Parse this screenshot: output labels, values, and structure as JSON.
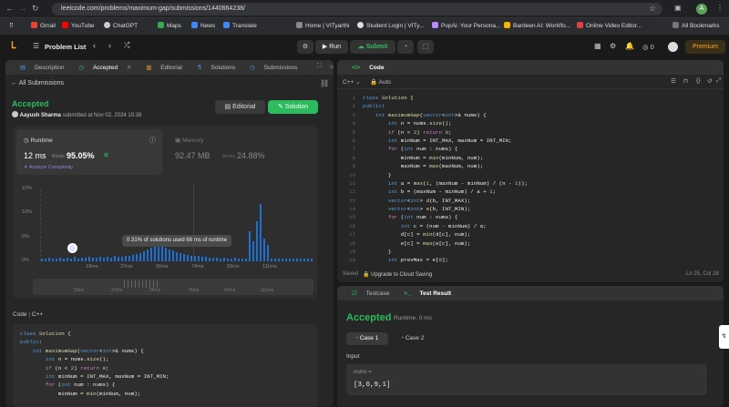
{
  "browser": {
    "url": "leetcode.com/problems/maximum-gap/submissions/1440664238/",
    "avatar": "A",
    "bookmarks": [
      "Gmail",
      "YouTube",
      "ChatGPT",
      "Maps",
      "News",
      "Translate",
      "Home | VITyarthi",
      "Student Login | VITy...",
      "PopAi: Your Persona...",
      "Bardeen AI: Workflo...",
      "Online Video Editor...",
      "All Bookmarks"
    ]
  },
  "nav": {
    "problem_list": "Problem List",
    "run": "Run",
    "submit": "Submit",
    "coins": "0",
    "premium": "Premium"
  },
  "left": {
    "tabs": [
      "Description",
      "Accepted",
      "Editorial",
      "Solutions",
      "Submissions"
    ],
    "all_submissions": "All Submissions",
    "status": "Accepted",
    "user": "Aayush Sharma",
    "submitted": "submitted at Nov 02, 2024 15:38",
    "editorial_btn": "Editorial",
    "solution_btn": "Solution",
    "runtime_label": "Runtime",
    "runtime_val": "12 ms",
    "beats_label": "Beats",
    "beats_val": "95.05%",
    "analyze": "Analyze Complexity",
    "memory_label": "Memory",
    "memory_val": "92.47 MB",
    "memory_beats_label": "Beats",
    "memory_beats": "24.88%",
    "tooltip": "0.31% of solutions used 68 ms of runtime",
    "yticks": [
      "15%",
      "10%",
      "5%",
      "0%"
    ],
    "xticks": [
      "19ms",
      "37ms",
      "56ms",
      "74ms",
      "93ms",
      "111ms"
    ],
    "code_label": "Code",
    "lang": "C++"
  },
  "editor": {
    "title": "Code",
    "lang": "C++",
    "auto": "Auto",
    "saved": "Saved",
    "upgrade": "Upgrade to Cloud Saving",
    "pos": "Ln 25, Col 28"
  },
  "result": {
    "tabs": [
      "Testcase",
      "Test Result"
    ],
    "status": "Accepted",
    "runtime": "Runtime: 0 ms",
    "cases": [
      "Case 1",
      "Case 2"
    ],
    "input_label": "Input",
    "param": "nums =",
    "value": "[3,6,9,1]"
  }
}
